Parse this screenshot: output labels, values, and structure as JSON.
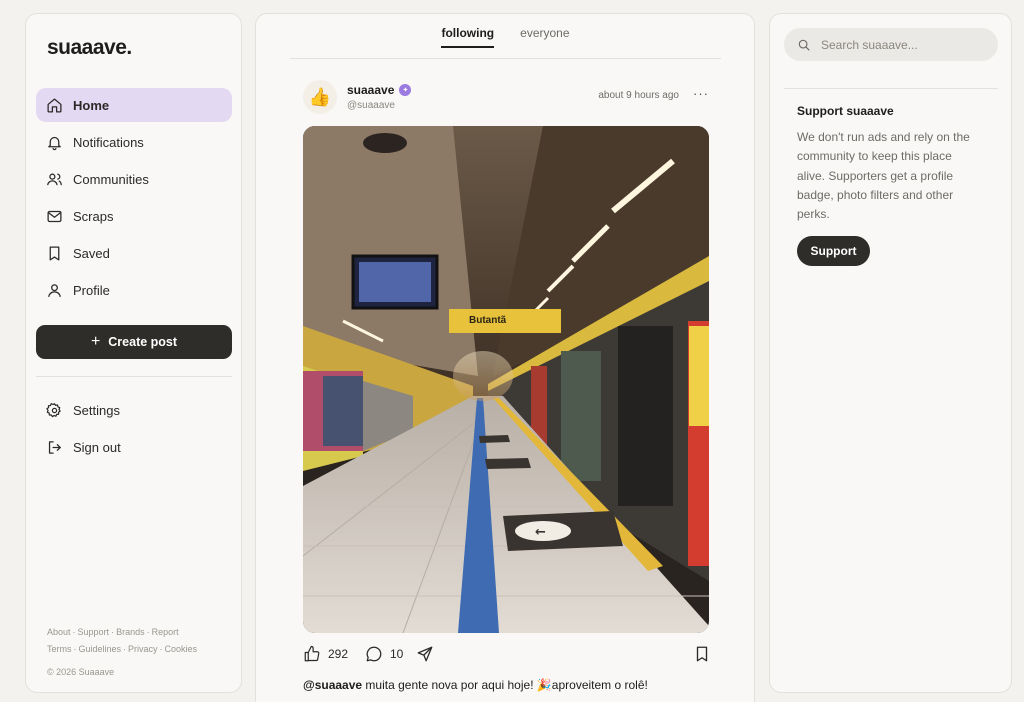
{
  "brand": {
    "logo": "suaaave."
  },
  "sidebar": {
    "items": [
      {
        "label": "Home",
        "icon": "home-icon",
        "active": true
      },
      {
        "label": "Notifications",
        "icon": "bell-icon"
      },
      {
        "label": "Communities",
        "icon": "users-icon"
      },
      {
        "label": "Scraps",
        "icon": "mail-icon"
      },
      {
        "label": "Saved",
        "icon": "bookmark-icon"
      },
      {
        "label": "Profile",
        "icon": "user-icon"
      }
    ],
    "create_post": "Create post",
    "secondary": [
      {
        "label": "Settings",
        "icon": "gear-icon"
      },
      {
        "label": "Sign out",
        "icon": "sign-out-icon"
      }
    ],
    "footer_links_row1": [
      "About",
      "Support",
      "Brands",
      "Report"
    ],
    "footer_links_row2": [
      "Terms",
      "Guidelines",
      "Privacy",
      "Cookies"
    ],
    "copyright": "© 2026 Suaaave"
  },
  "feed": {
    "tabs": [
      {
        "label": "following",
        "active": true
      },
      {
        "label": "everyone"
      }
    ],
    "post": {
      "avatar_emoji": "👍",
      "username": "suaaave",
      "handle": "@suaaave",
      "time": "about 9 hours ago",
      "more": "···",
      "likes": "292",
      "comments": "10",
      "caption_user": "@suaaave",
      "caption_text": " muita gente nova por aqui hoje! 🎉aproveitem o rolê!",
      "photo": {
        "sign_text": "Butantã",
        "floor_arrow": "←"
      }
    }
  },
  "right": {
    "search_placeholder": "Search suaaave...",
    "support": {
      "title": "Support suaaave",
      "text": "We don't run ads and rely on the community to keep this place alive. Supporters get a profile badge, photo filters and other perks.",
      "button": "Support"
    }
  },
  "colors": {
    "active_nav": "#e4d9f2",
    "dark_button": "#2f2d2a",
    "badge": "#9b7be0"
  }
}
